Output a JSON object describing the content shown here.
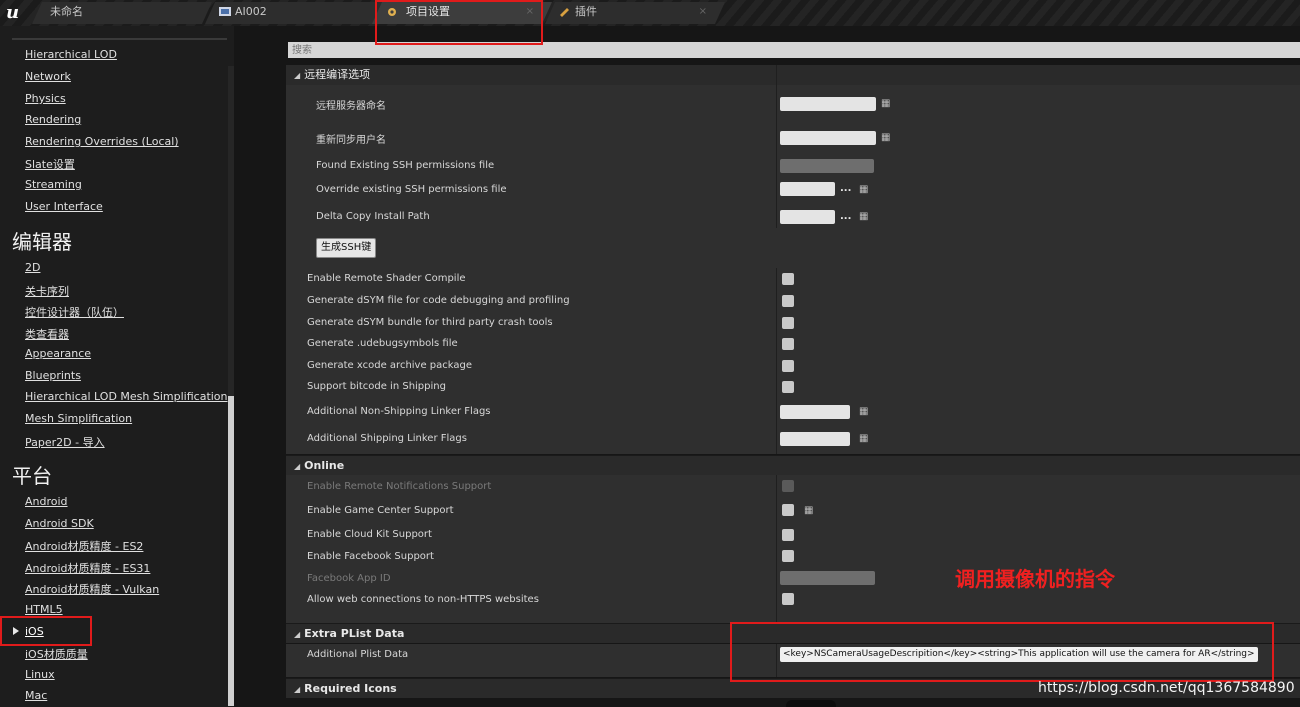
{
  "tabs": [
    {
      "label": "未命名",
      "icon": "ue-level-icon",
      "active": false
    },
    {
      "label": "AI002",
      "icon": "blueprint-icon",
      "active": false
    },
    {
      "label": "项目设置",
      "icon": "settings-icon",
      "active": true
    },
    {
      "label": "插件",
      "icon": "plugin-icon",
      "active": false
    }
  ],
  "sidebar": {
    "items_engine": [
      "Hierarchical LOD",
      "Network",
      "Physics",
      "Rendering",
      "Rendering Overrides (Local)",
      "Slate设置",
      "Streaming",
      "User Interface"
    ],
    "heading_editor": "编辑器",
    "items_editor": [
      "2D",
      "关卡序列",
      "控件设计器（队伍）",
      "类查看器",
      "Appearance",
      "Blueprints",
      "Hierarchical LOD Mesh Simplification",
      "Mesh Simplification",
      "Paper2D - 导入"
    ],
    "heading_platform": "平台",
    "items_platform": [
      "Android",
      "Android SDK",
      "Android材质精度 - ES2",
      "Android材质精度 - ES31",
      "Android材质精度 - Vulkan",
      "HTML5",
      "iOS",
      "iOS材质质量",
      "Linux",
      "Mac"
    ],
    "selected": "iOS"
  },
  "search": {
    "placeholder": "搜索"
  },
  "remote": {
    "title": "远程编译选项",
    "server_name": "远程服务器命名",
    "resync_user": "重新同步用户名",
    "found_ssh": "Found Existing SSH permissions file",
    "override_ssh": "Override existing SSH permissions file",
    "delta_copy": "Delta Copy Install Path",
    "gen_ssh_button": "生成SSH键",
    "shader_compile": "Enable Remote Shader Compile",
    "dsym_file": "Generate dSYM file for code debugging and profiling",
    "dsym_bundle": "Generate dSYM bundle for third party crash tools",
    "udebug": "Generate .udebugsymbols file",
    "xcode_archive": "Generate xcode archive package",
    "bitcode": "Support bitcode in Shipping",
    "nonship_flags": "Additional Non-Shipping Linker Flags",
    "ship_flags": "Additional Shipping Linker Flags",
    "dots": "..."
  },
  "online": {
    "title": "Online",
    "remote_notif": "Enable Remote Notifications Support",
    "game_center": "Enable Game Center Support",
    "cloud_kit": "Enable Cloud Kit Support",
    "facebook": "Enable Facebook Support",
    "facebook_id": "Facebook App ID",
    "non_https": "Allow web connections to non-HTTPS websites"
  },
  "plist": {
    "title": "Extra PList Data",
    "label": "Additional Plist Data",
    "value": "<key>NSCameraUsageDescripition</key><string>This application will use the camera for AR</string>"
  },
  "required_icons": {
    "title": "Required Icons"
  },
  "annotation": {
    "text": "调用摄像机的指令",
    "color": "#e01b1b"
  },
  "watermark": "https://blog.csdn.net/qq1367584890"
}
